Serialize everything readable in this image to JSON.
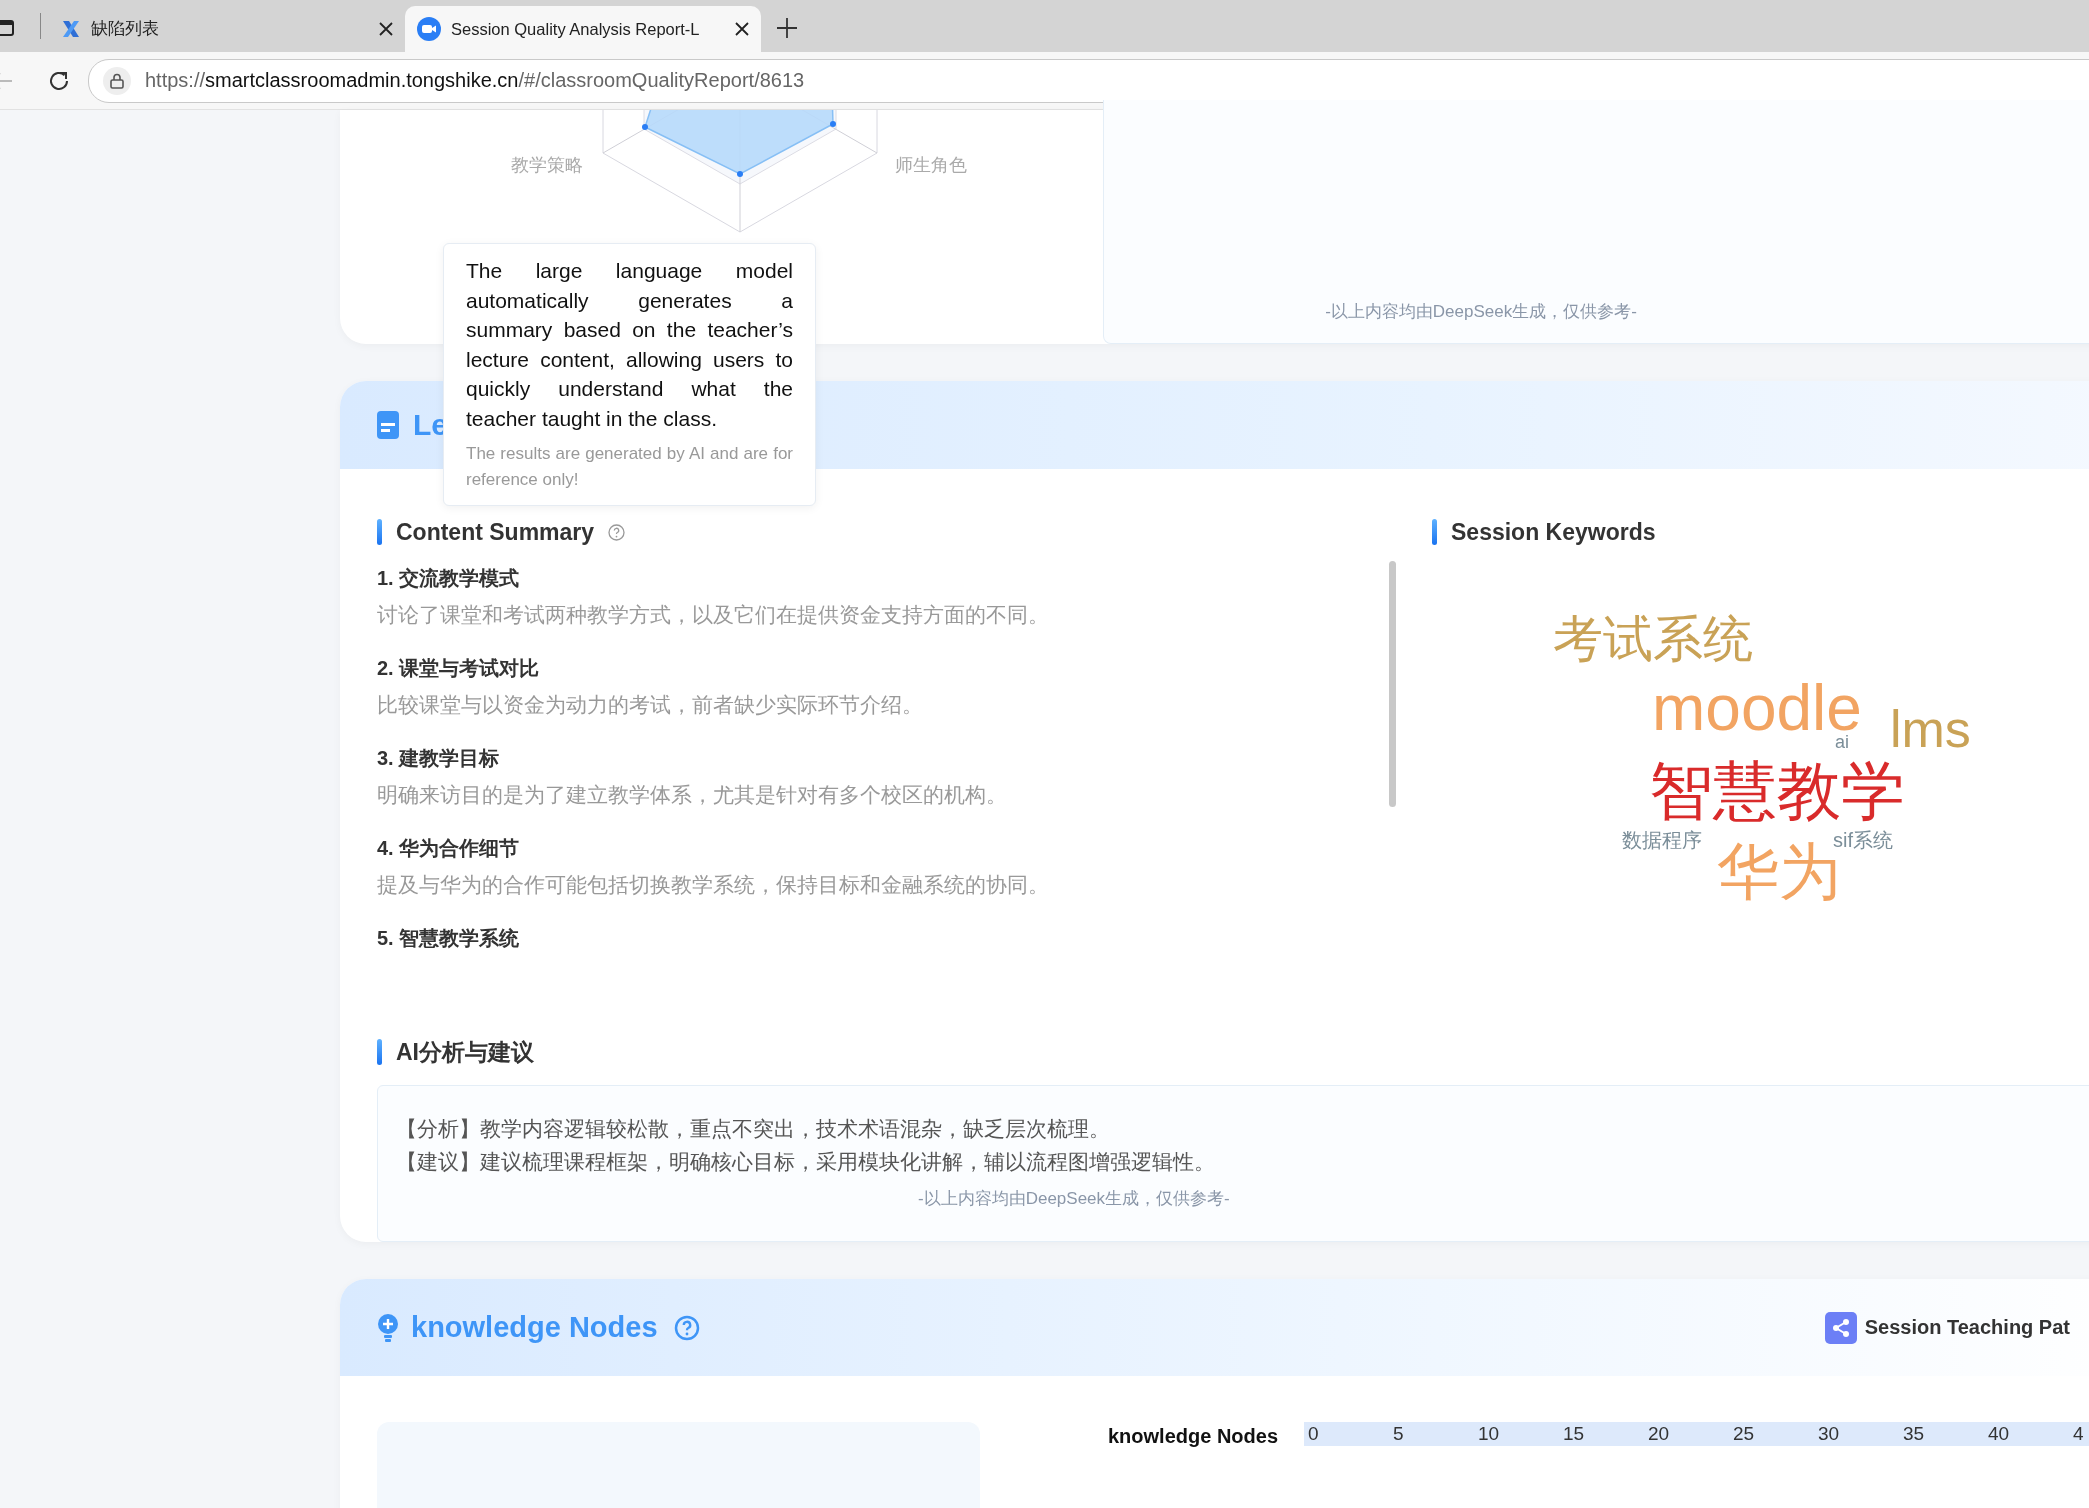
{
  "browser": {
    "tabs": [
      {
        "title": "缺陷列表",
        "selected": false,
        "kind": "x-logo"
      },
      {
        "title": "Session Quality Analysis Report-L",
        "selected": true,
        "kind": "meeting"
      }
    ],
    "url": {
      "scheme": "https://",
      "host": "smartclassroomadmin.tongshike.cn",
      "path": "/#/classroomQualityReport/8613"
    }
  },
  "radar": {
    "labels": [
      "教学策略",
      "师生角色"
    ]
  },
  "radar_note": "-以上内容均由DeepSeek生成，仅供参考-",
  "lecture_section": {
    "title": "Le",
    "tooltip": {
      "text": "The large language model automatically generates a summary based on the teacher’s lecture content, allowing users to quickly understand what the teacher taught in the class.",
      "note": "The results are generated by AI and are for reference only!"
    },
    "content_summary": {
      "title": "Content Summary",
      "items": [
        {
          "title": "1. 交流教学模式",
          "description": "讨论了课堂和考试两种教学方式，以及它们在提供资金支持方面的不同。"
        },
        {
          "title": "2. 课堂与考试对比",
          "description": "比较课堂与以资金为动力的考试，前者缺少实际环节介绍。"
        },
        {
          "title": "3. 建教学目标",
          "description": "明确来访目的是为了建立教学体系，尤其是针对有多个校区的机构。"
        },
        {
          "title": "4. 华为合作细节",
          "description": "提及与华为的合作可能包括切换教学系统，保持目标和金融系统的协同。"
        },
        {
          "title": "5. 智慧教学系统"
        }
      ]
    },
    "keywords": {
      "title": "Session Keywords",
      "words": [
        {
          "text": "考试系统",
          "color": "#c9a256"
        },
        {
          "text": "moodle",
          "color": "#f2a462"
        },
        {
          "text": "ai",
          "color": "#7b8e99"
        },
        {
          "text": "lms",
          "color": "#c9a256"
        },
        {
          "text": "智慧教学",
          "color": "#d92b2b"
        },
        {
          "text": "数据程序",
          "color": "#7b8e99"
        },
        {
          "text": "sif系统",
          "color": "#7b8e99"
        },
        {
          "text": "华为",
          "color": "#f2a462"
        }
      ]
    },
    "ai_analysis": {
      "title": "AI分析与建议",
      "lines": [
        "【分析】教学内容逻辑较松散，重点不突出，技术术语混杂，缺乏层次梳理。",
        "【建议】建议梳理课程框架，明确核心目标，采用模块化讲解，辅以流程图增强逻辑性。"
      ],
      "note": "-以上内容均由DeepSeek生成，仅供参考-"
    }
  },
  "knowledge_section": {
    "title": "knowledge Nodes",
    "right_title": "Session Teaching Pat",
    "axis": {
      "label": "knowledge Nodes",
      "ticks": [
        "0",
        "5",
        "10",
        "15",
        "20",
        "25",
        "30",
        "35",
        "40",
        "4"
      ]
    }
  }
}
